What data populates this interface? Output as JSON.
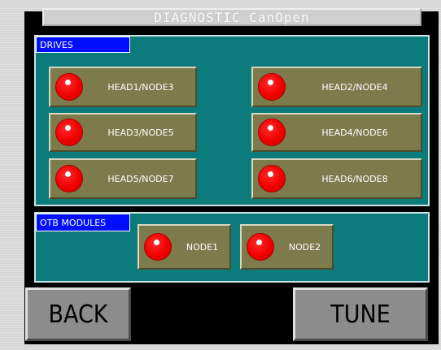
{
  "title": "DIAGNOSTIC CanOpen",
  "drives": {
    "label": "DRIVES",
    "nodes": [
      {
        "label": "HEAD1/NODE3",
        "status": "red"
      },
      {
        "label": "HEAD2/NODE4",
        "status": "red"
      },
      {
        "label": "HEAD3/NODE5",
        "status": "red"
      },
      {
        "label": "HEAD4/NODE6",
        "status": "red"
      },
      {
        "label": "HEAD5/NODE7",
        "status": "red"
      },
      {
        "label": "HEAD6/NODE8",
        "status": "red"
      }
    ]
  },
  "otb": {
    "label": "OTB MODULES",
    "nodes": [
      {
        "label": "NODE1",
        "status": "red"
      },
      {
        "label": "NODE2",
        "status": "red"
      }
    ]
  },
  "buttons": {
    "back": "BACK",
    "tune": "TUNE"
  },
  "colors": {
    "panel_bg": "#000000",
    "group_bg": "#0b7b7b",
    "group_label_bg": "#0010ff",
    "node_bg": "#7d7a4b",
    "led_red": "#f00000",
    "button_bg": "#8c8c8c"
  }
}
